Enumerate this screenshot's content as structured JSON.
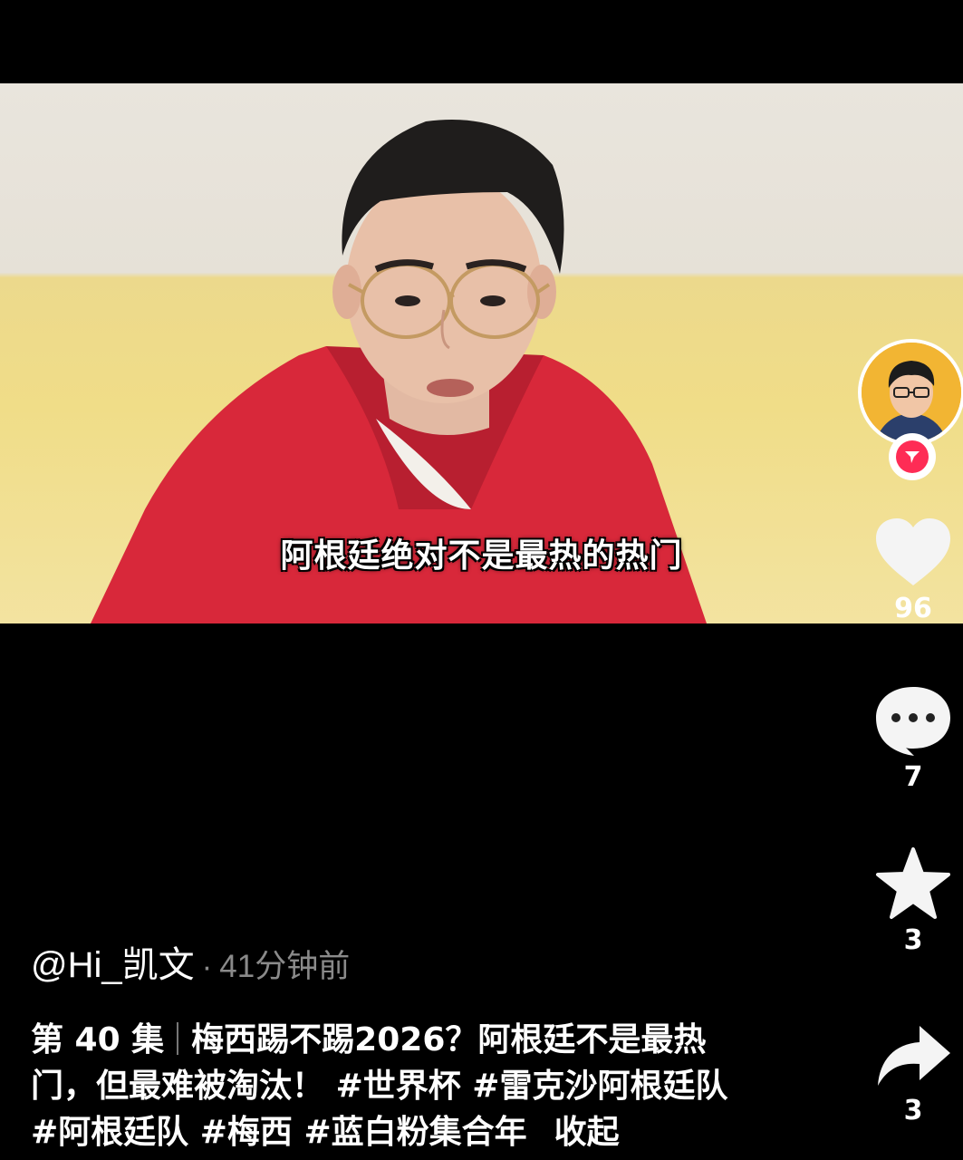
{
  "video": {
    "subtitle": "阿根廷绝对不是最热的热门"
  },
  "actions": {
    "like_count": "96",
    "comment_count": "7",
    "favorite_count": "3",
    "share_count": "3"
  },
  "author": {
    "handle": "@Hi_凯文",
    "separator": "·",
    "time": "41分钟前"
  },
  "description": {
    "episode": "第 40 集",
    "text": "梅西踢不踢2026？阿根廷不是最热门，但最难被淘汰！",
    "tags": [
      "#世界杯",
      "#雷克沙阿根廷队",
      "#阿根廷队",
      "#梅西",
      "#蓝白粉集合年"
    ],
    "collapse_label": "收起"
  },
  "colors": {
    "background": "#000000",
    "accent": "#fe2c55",
    "secondary_text": "#8a8a8a"
  },
  "icons": [
    "heart-icon",
    "comment-icon",
    "star-icon",
    "share-icon",
    "follow-plus-icon"
  ]
}
